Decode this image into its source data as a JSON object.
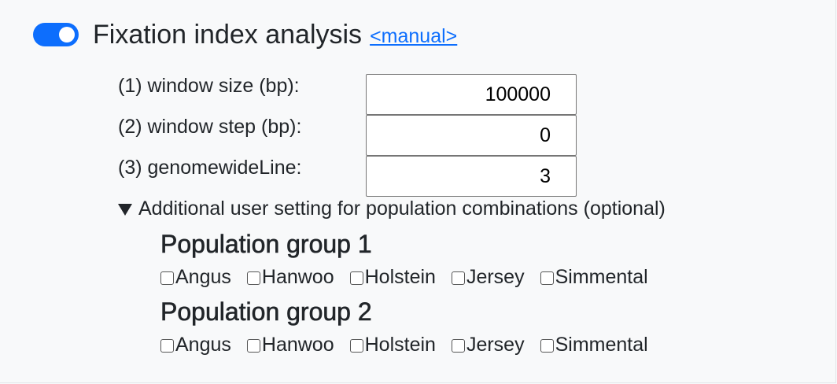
{
  "section": {
    "title": "Fixation index analysis",
    "manual_link": "<manual>",
    "enabled": true,
    "accent_color": "#0d6efd"
  },
  "params": [
    {
      "label": "(1) window size (bp):",
      "value": "100000"
    },
    {
      "label": "(2) window step (bp):",
      "value": "0"
    },
    {
      "label": "(3) genomewideLine:",
      "value": "3"
    }
  ],
  "additional": {
    "summary": "Additional user setting for population combinations (optional)",
    "expanded": true,
    "groups": [
      {
        "title": "Population group 1",
        "options": [
          {
            "label": "Angus",
            "checked": false
          },
          {
            "label": "Hanwoo",
            "checked": false
          },
          {
            "label": "Holstein",
            "checked": false
          },
          {
            "label": "Jersey",
            "checked": false
          },
          {
            "label": "Simmental",
            "checked": false
          }
        ]
      },
      {
        "title": "Population group 2",
        "options": [
          {
            "label": "Angus",
            "checked": false
          },
          {
            "label": "Hanwoo",
            "checked": false
          },
          {
            "label": "Holstein",
            "checked": false
          },
          {
            "label": "Jersey",
            "checked": false
          },
          {
            "label": "Simmental",
            "checked": false
          }
        ]
      }
    ]
  }
}
